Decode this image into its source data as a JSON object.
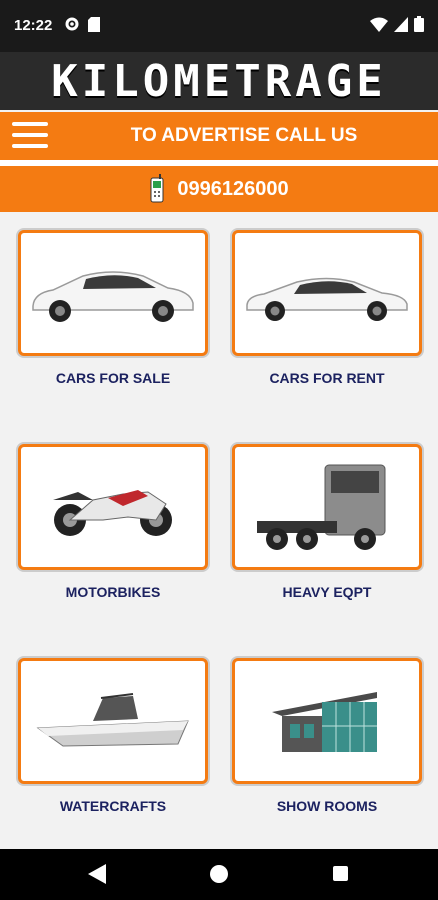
{
  "status": {
    "time": "12:22"
  },
  "logo": {
    "text": "KILOMETRAGE"
  },
  "header": {
    "advert_text": "TO ADVERTISE CALL US",
    "phone": "0996126000"
  },
  "categories": [
    {
      "label": "CARS FOR SALE",
      "icon": "suv-car-icon"
    },
    {
      "label": "CARS FOR RENT",
      "icon": "sedan-car-icon"
    },
    {
      "label": "MOTORBIKES",
      "icon": "motorbike-icon"
    },
    {
      "label": "HEAVY EQPT",
      "icon": "truck-icon"
    },
    {
      "label": "WATERCRAFTS",
      "icon": "boat-icon"
    },
    {
      "label": "SHOW ROOMS",
      "icon": "showroom-icon"
    }
  ],
  "colors": {
    "accent": "#f47b12",
    "label": "#1c2260",
    "logo_bg": "#2b2b2b"
  }
}
